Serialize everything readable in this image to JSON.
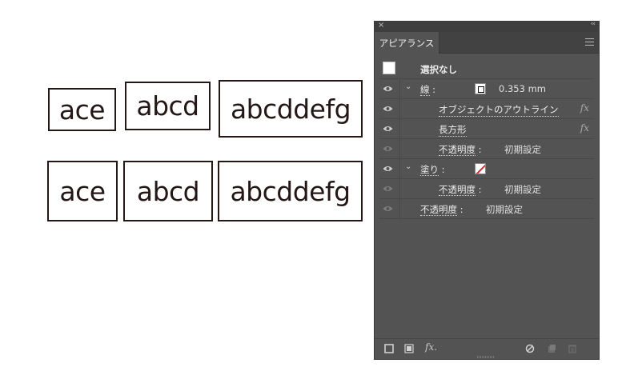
{
  "canvas": {
    "row1": [
      "ace",
      "abcd",
      "abcddefg"
    ],
    "row2": [
      "ace",
      "abcd",
      "abcddefg"
    ]
  },
  "panel": {
    "tab_label": "アピアランス",
    "close_glyph": "×",
    "collapse_glyph": "‹‹",
    "rows": {
      "selection": "選択なし",
      "stroke_label": "線",
      "stroke_colon": ":",
      "stroke_weight": "0.353 mm",
      "outline_effect": "オブジェクトのアウトライン",
      "rectangle_effect": "長方形",
      "stroke_opacity_label": "不透明度",
      "stroke_opacity_colon": ":",
      "stroke_opacity_value": "初期設定",
      "fill_label": "塗り",
      "fill_colon": ":",
      "fill_opacity_label": "不透明度",
      "fill_opacity_colon": ":",
      "fill_opacity_value": "初期設定",
      "object_opacity_label": "不透明度",
      "object_opacity_colon": ":",
      "object_opacity_value": "初期設定"
    },
    "fx_glyph": "fx",
    "bottom_fx": "fx.",
    "colors": {
      "panel_bg": "#535353",
      "ink": "#231815",
      "none_slash": "#e0252b"
    }
  }
}
